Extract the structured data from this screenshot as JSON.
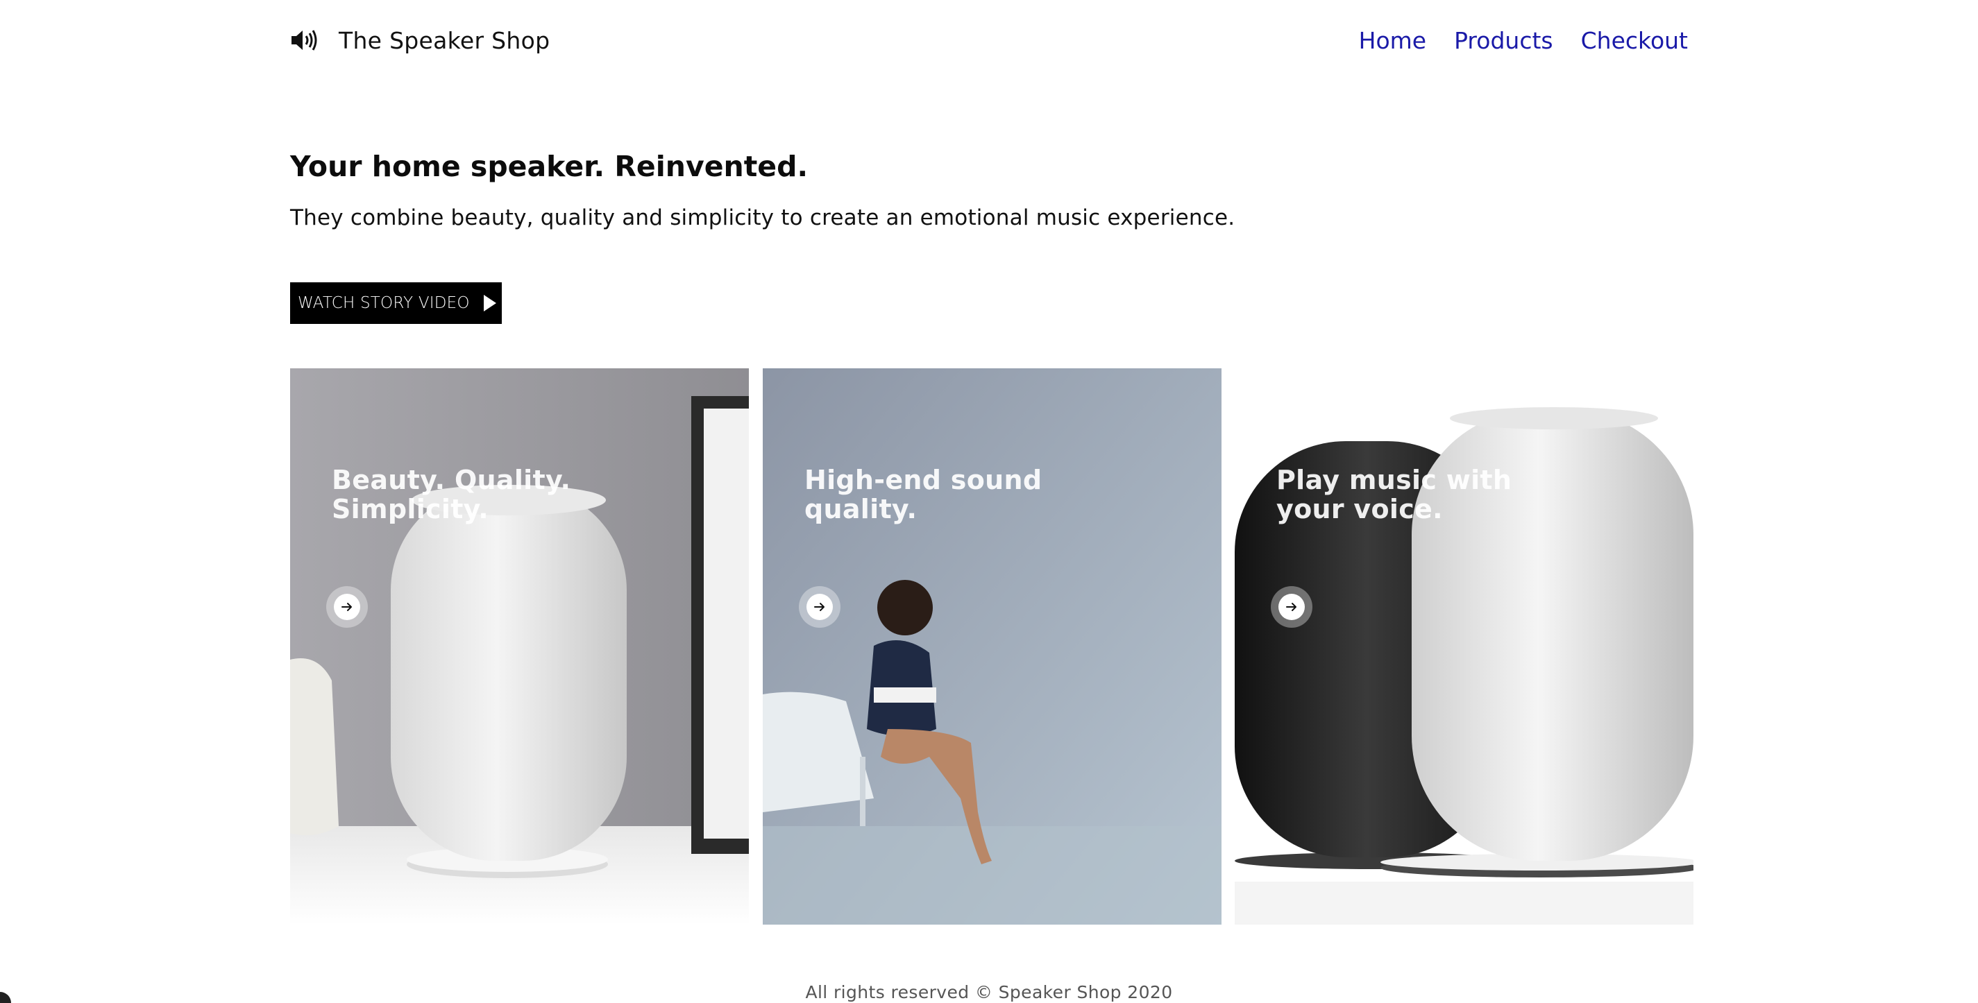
{
  "header": {
    "brand": "The Speaker Shop",
    "brand_icon": "speaker-icon",
    "nav": [
      "Home",
      "Products",
      "Checkout"
    ],
    "nav_color": "#1a1aa8"
  },
  "hero": {
    "title": "Your home speaker. Reinvented.",
    "subtitle": "They combine beauty, quality and simplicity to create an emotional music experience.",
    "button_label": "WATCH STORY VIDEO",
    "button_icon": "play-icon"
  },
  "cards": [
    {
      "title": "Beauty. Quality. Simplicity.",
      "icon": "arrow-right-icon"
    },
    {
      "title": "High-end sound quality.",
      "icon": "arrow-right-icon"
    },
    {
      "title": "Play music with your voice.",
      "icon": "arrow-right-icon"
    }
  ],
  "footer": "All rights reserved © Speaker Shop 2020"
}
